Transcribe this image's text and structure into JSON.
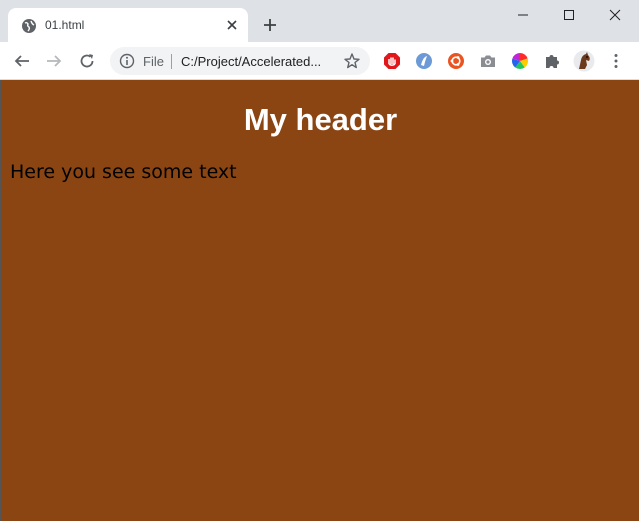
{
  "browser": {
    "tab_title": "01.html",
    "omnibox": {
      "scheme_label": "File",
      "url": "C:/Project/Accelerated..."
    },
    "extensions": [
      "adblock-icon",
      "vpn-icon",
      "ubuntu-icon",
      "camera-icon",
      "color-wheel-icon",
      "puzzle-icon"
    ],
    "colors": {
      "titlebar": "#dee1e6",
      "toolbar": "#ffffff",
      "omnibox": "#f1f3f4"
    }
  },
  "page": {
    "header": "My header",
    "text": "Here you see some text",
    "colors": {
      "background": "#8b4513",
      "header_text": "#ffffff",
      "body_text": "#000000"
    }
  }
}
